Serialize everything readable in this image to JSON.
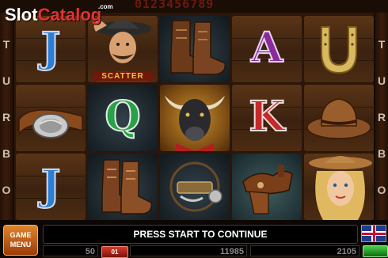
{
  "top": {
    "digits": "0123456789"
  },
  "watermark": {
    "slot": "Slot",
    "catalog": "Catalog",
    "com": ".com"
  },
  "side_left": [
    "T",
    "U",
    "R",
    "B",
    "O"
  ],
  "side_right": [
    "T",
    "U",
    "R",
    "B",
    "O"
  ],
  "reels": {
    "col1": [
      "J",
      "belt-buckle",
      "J"
    ],
    "col2": [
      "cowboy-man",
      "Q",
      "boots"
    ],
    "col3": [
      "boots",
      "bull",
      "spurs"
    ],
    "col4": [
      "A",
      "K",
      "saddle"
    ],
    "col5": [
      "horseshoe",
      "cowboy-hat",
      "cowgirl"
    ],
    "scatter_label": "SCATTER"
  },
  "bottom": {
    "game_menu_line1": "GAME",
    "game_menu_line2": "MENU",
    "message": "PRESS START TO CONTINUE",
    "lines": "50",
    "bet_button": "01",
    "credit": "11985",
    "win": "2105"
  },
  "colors": {
    "accent": "#e0842a",
    "message_bg": "#000000"
  }
}
